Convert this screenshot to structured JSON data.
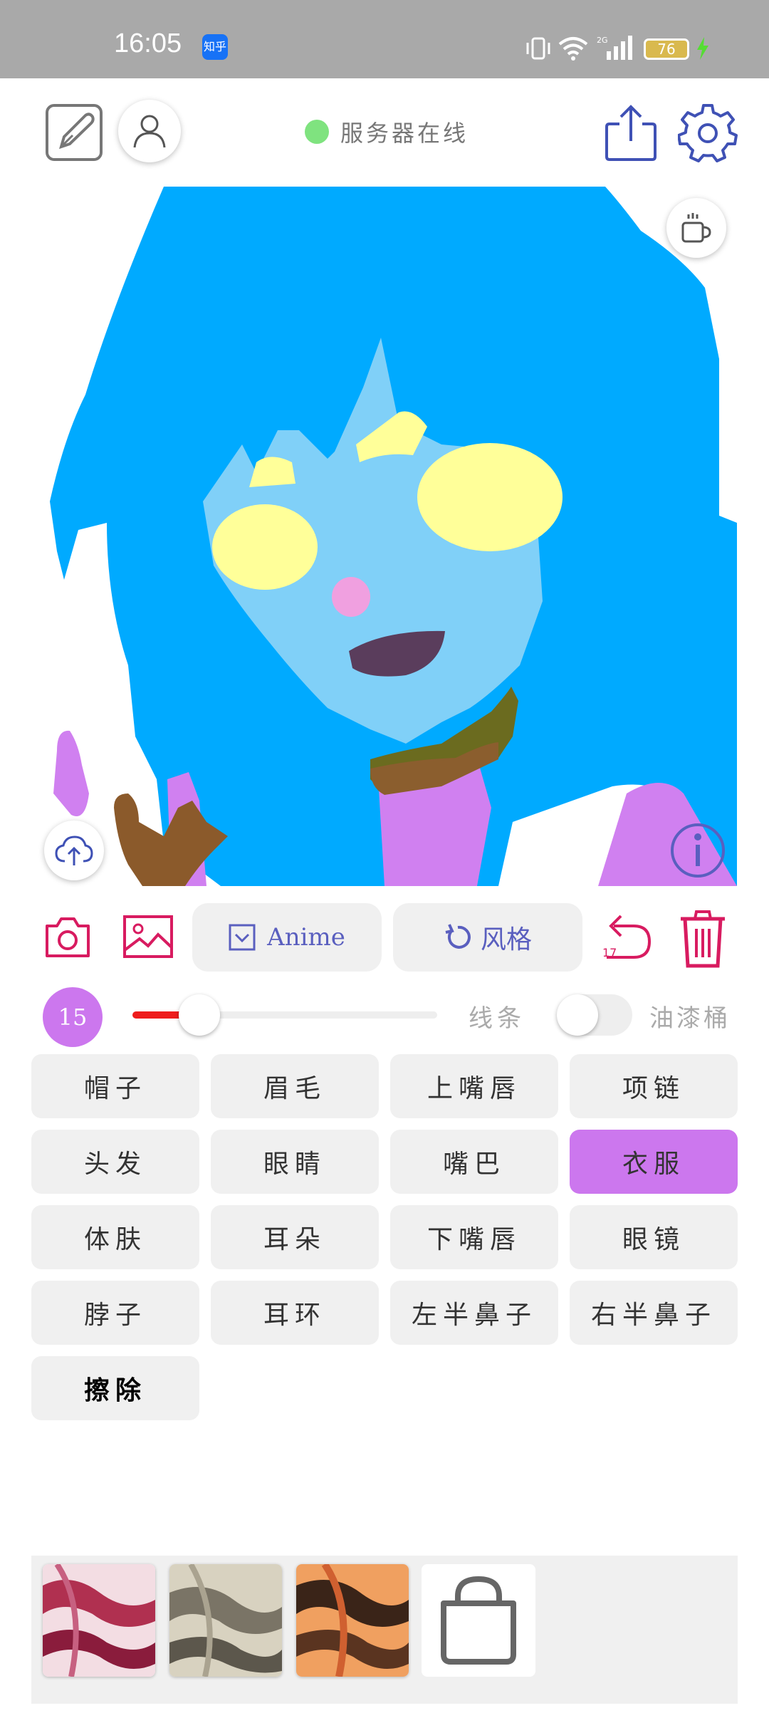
{
  "status_bar": {
    "time": "16:05",
    "app_badge": "知乎",
    "battery": "76"
  },
  "header": {
    "server_status": "服务器在线"
  },
  "toolbar": {
    "anime_label": "Anime",
    "style_label": "风格",
    "undo_count": "17"
  },
  "brush": {
    "size": "15",
    "slider_fraction": 0.22,
    "line_label": "线条",
    "bucket_label": "油漆桶",
    "bucket_enabled": false
  },
  "parts": [
    {
      "label": "帽子",
      "selected": false
    },
    {
      "label": "眉毛",
      "selected": false
    },
    {
      "label": "上嘴唇",
      "selected": false
    },
    {
      "label": "项链",
      "selected": false
    },
    {
      "label": "头发",
      "selected": false
    },
    {
      "label": "眼睛",
      "selected": false
    },
    {
      "label": "嘴巴",
      "selected": false
    },
    {
      "label": "衣服",
      "selected": true
    },
    {
      "label": "体肤",
      "selected": false
    },
    {
      "label": "耳朵",
      "selected": false
    },
    {
      "label": "下嘴唇",
      "selected": false
    },
    {
      "label": "眼镜",
      "selected": false
    },
    {
      "label": "脖子",
      "selected": false
    },
    {
      "label": "耳环",
      "selected": false
    },
    {
      "label": "左半鼻子",
      "selected": false
    },
    {
      "label": "右半鼻子",
      "selected": false
    },
    {
      "label": "擦除",
      "selected": false
    }
  ],
  "colors": {
    "accent_purple": "#cc77ee",
    "accent_red": "#d81b60",
    "icon_blue": "#5a5fbf",
    "hair": "#00aaff",
    "skin": "#80d0f8",
    "eyes": "#ffff99",
    "server_online": "#7fe37f"
  },
  "icons": {
    "edit": "edit-square-icon",
    "user": "user-icon",
    "share": "share-icon",
    "settings": "gear-icon",
    "coffee": "coffee-icon",
    "upload": "cloud-upload-icon",
    "info": "info-icon",
    "camera": "camera-icon",
    "gallery": "image-icon",
    "undo": "undo-icon",
    "trash": "trash-icon",
    "shop": "shopping-bag-icon"
  }
}
